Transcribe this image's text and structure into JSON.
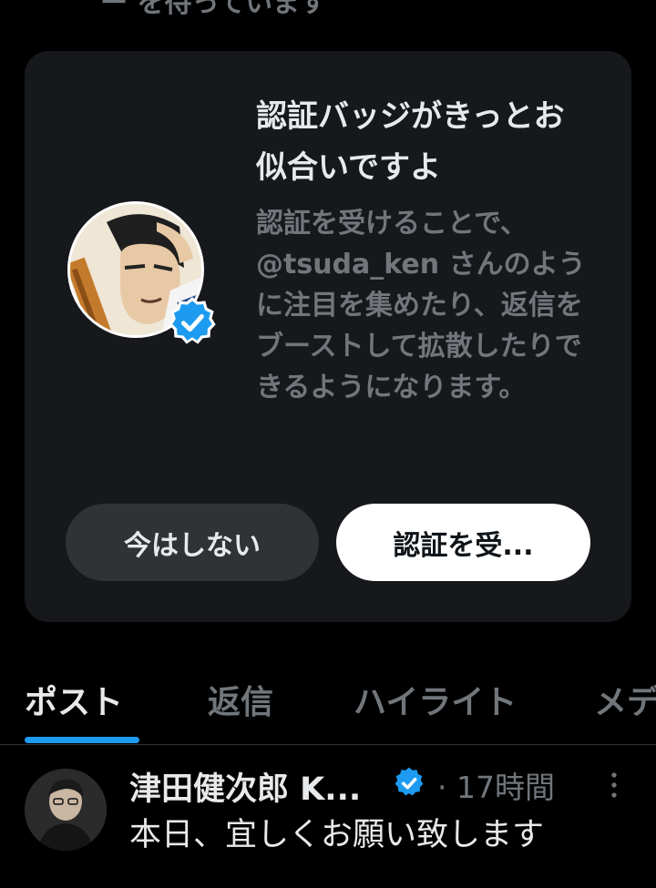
{
  "top_partial_text": "ー を待っています",
  "promo": {
    "title": "認証バッジがきっとお似合いですよ",
    "description": "認証を受けることで、@tsuda_ken さんのように注目を集めたり、返信をブーストして拡散したりできるようになります。",
    "avatar_icon": "anime-character-avatar",
    "badge_icon": "verified-badge-icon",
    "not_now_label": "今はしない",
    "verify_label": "認証を受..."
  },
  "tabs": [
    {
      "label": "ポスト",
      "active": true
    },
    {
      "label": "返信",
      "active": false
    },
    {
      "label": "ハイライト",
      "active": false
    },
    {
      "label": "メデ",
      "active": false
    }
  ],
  "post": {
    "author": "津田健次郎 K...",
    "time": "· 17時間",
    "text": "本日、宜しくお願い致します"
  },
  "colors": {
    "accent": "#1d9bf0",
    "background": "#000000",
    "card": "#16181c",
    "secondary_text": "#71767b"
  }
}
